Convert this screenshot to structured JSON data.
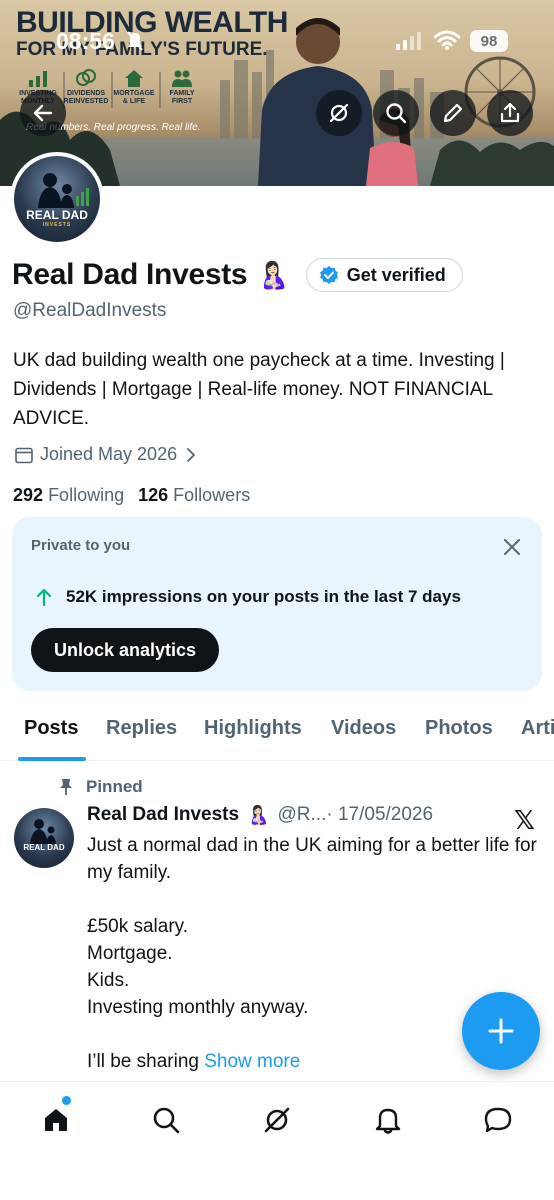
{
  "status_bar": {
    "time": "08:56",
    "battery": "98"
  },
  "banner": {
    "title": "BUILDING WEALTH",
    "subtitle": "FOR MY FAMILY'S FUTURE.",
    "tagline": "Real numbers. Real progress. Real life.",
    "icon_labels": [
      "INVESTING MONTHLY",
      "DIVIDENDS REINVESTED",
      "MORTGAGE & LIFE",
      "FAMILY FIRST"
    ]
  },
  "profile": {
    "avatar_text": "REAL DAD",
    "avatar_sub": "INVESTS",
    "display_name": "Real Dad Invests",
    "name_emoji": "🤱🏻",
    "verify_label": "Get verified",
    "handle": "@RealDadInvests",
    "bio": "UK dad building wealth one paycheck at a time. Investing | Dividends | Mortgage | Real-life money. NOT FINANCIAL ADVICE.",
    "joined": "Joined May 2026",
    "following_count": "292",
    "following_label": "Following",
    "followers_count": "126",
    "followers_label": "Followers"
  },
  "private_card": {
    "label": "Private to you",
    "stat": "52K impressions on your posts in the last 7 days",
    "button": "Unlock analytics"
  },
  "tabs": [
    "Posts",
    "Replies",
    "Highlights",
    "Videos",
    "Photos",
    "Articles"
  ],
  "active_tab": "Posts",
  "pinned_post": {
    "pinned_label": "Pinned",
    "author": "Real Dad Invests",
    "author_emoji": "🤱🏻",
    "handle": "@R...",
    "date": "· 17/05/2026",
    "source_logo": "𝕏",
    "lines": [
      "Just a normal dad in the UK aiming for a better life for my family.",
      "£50k salary.",
      "Mortgage.",
      "Kids.",
      "Investing monthly anyway.",
      "I’ll be sharing"
    ],
    "show_more": "Show more"
  },
  "icons": [
    "back-arrow-icon",
    "grok-icon",
    "search-icon",
    "edit-pencil-icon",
    "share-icon",
    "calendar-icon",
    "chevron-right-icon",
    "verified-badge-icon",
    "close-icon",
    "arrow-up-icon",
    "pin-icon",
    "plus-icon",
    "home-icon",
    "notifications-bell-icon",
    "messages-icon"
  ],
  "colors": {
    "accent": "#1d9bf0",
    "text": "#0f1419",
    "muted": "#536471",
    "card_bg": "#e8f5fd"
  }
}
